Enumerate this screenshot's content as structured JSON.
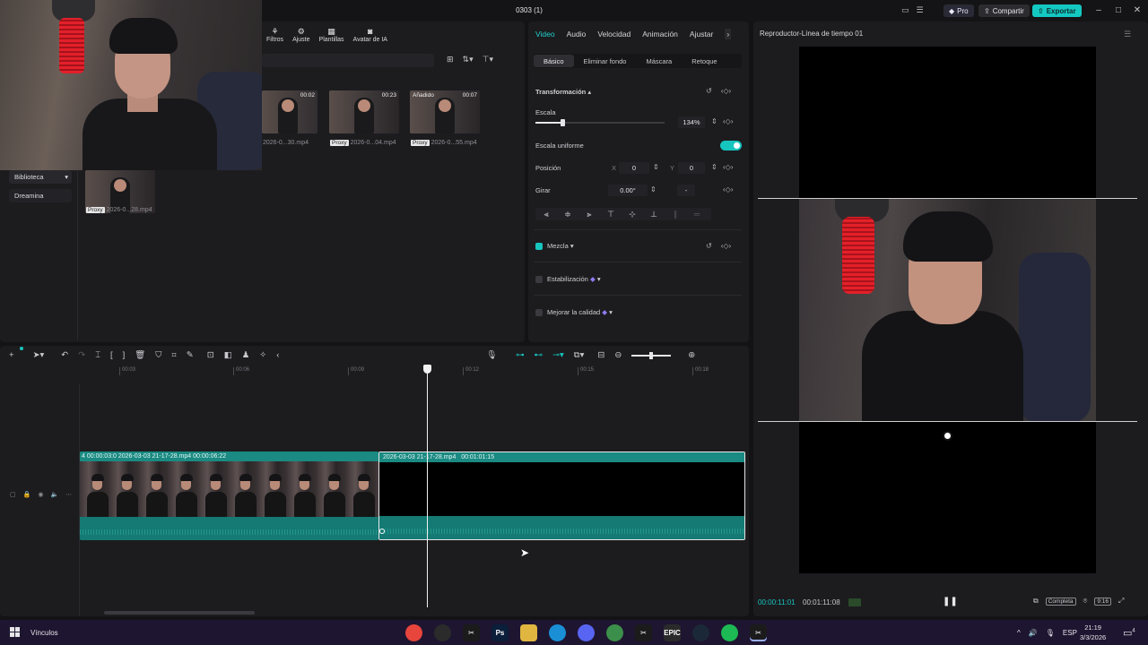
{
  "window": {
    "title": "0303 (1)",
    "pro_label": "Pro",
    "share_label": "Compartir",
    "export_label": "Exportar"
  },
  "media": {
    "tabs": [
      {
        "icon": "filters-icon",
        "label": "Filtros"
      },
      {
        "icon": "adjust-icon",
        "label": "Ajuste"
      },
      {
        "icon": "templates-icon",
        "label": "Plantillas"
      },
      {
        "icon": "ai-avatar-icon",
        "label": "Avatar de IA"
      }
    ],
    "sidebar": {
      "library": "Biblioteca",
      "dreamina": "Dreamina"
    },
    "items": [
      {
        "duration": "00:02",
        "name": "2026-0...30.mp4",
        "proxy": ""
      },
      {
        "duration": "00:23",
        "name": "2026-0...04.mp4",
        "proxy": "Proxy"
      },
      {
        "duration": "00:07",
        "name": "2026-0...55.mp4",
        "proxy": "Proxy",
        "badge": "Añadido"
      },
      {
        "duration": "",
        "name": "2026-0...28.mp4",
        "proxy": "Proxy"
      }
    ]
  },
  "inspector": {
    "tabs": [
      "Video",
      "Audio",
      "Velocidad",
      "Animación",
      "Ajustar"
    ],
    "subtabs": [
      "Básico",
      "Eliminar fondo",
      "Máscara",
      "Retoque"
    ],
    "transform_label": "Transformación",
    "scale_label": "Escala",
    "scale_value": "134%",
    "scale_fraction": 0.21,
    "uniform_label": "Escala uniforme",
    "uniform_on": true,
    "position_label": "Posición",
    "x_label": "X",
    "x_value": "0",
    "y_label": "Y",
    "y_value": "0",
    "rotate_label": "Girar",
    "rotate_value": "0.00°",
    "rotate_reset": "-",
    "blend_label": "Mezcla",
    "stabilize_label": "Estabilización",
    "enhance_label": "Mejorar la calidad"
  },
  "player": {
    "title": "Reproductor-Línea de tiempo 01",
    "current_time": "00:00:11:01",
    "total_time": "00:01:11:08",
    "quality_label": "Completa",
    "ratio_label": "9:16"
  },
  "timeline": {
    "ruler": [
      "00:03",
      "00:06",
      "00:09",
      "00:12",
      "00:15",
      "00:18"
    ],
    "clip1_label": "4  00:00:03:0  2026-03-03 21-17-28.mp4  00:00:06:22",
    "clip2_label": "2026-03-03 21-17-28.mp4",
    "clip2_duration": "00:01:01:15"
  },
  "taskbar": {
    "links_label": "Vínculos",
    "apps": [
      {
        "icon": "chrome-icon",
        "glyph": "",
        "color": "#e8453c"
      },
      {
        "icon": "obs-icon",
        "glyph": "",
        "color": "#2b2b2b"
      },
      {
        "icon": "capcut-icon",
        "glyph": "✂",
        "color": "#1b1b1b"
      },
      {
        "icon": "photoshop-icon",
        "glyph": "Ps",
        "color": "#0b1e3a"
      },
      {
        "icon": "file-explorer-icon",
        "glyph": "",
        "color": "#e0b640"
      },
      {
        "icon": "edge-icon",
        "glyph": "",
        "color": "#1a8fd6"
      },
      {
        "icon": "discord-icon",
        "glyph": "",
        "color": "#5865f2"
      },
      {
        "icon": "chrome-profile-icon",
        "glyph": "",
        "color": "#3c8f4a"
      },
      {
        "icon": "capcut-2-icon",
        "glyph": "✂",
        "color": "#1b1b1b"
      },
      {
        "icon": "epic-games-icon",
        "glyph": "EPIC",
        "color": "#2a2a2a"
      },
      {
        "icon": "steam-icon",
        "glyph": "",
        "color": "#1b2838"
      },
      {
        "icon": "spotify-icon",
        "glyph": "",
        "color": "#1db954"
      },
      {
        "icon": "capcut-active-icon",
        "glyph": "✂",
        "color": "#1b1b1b"
      }
    ],
    "language": "ESP",
    "time": "21:19",
    "date": "3/3/2026",
    "notifications": "4"
  }
}
